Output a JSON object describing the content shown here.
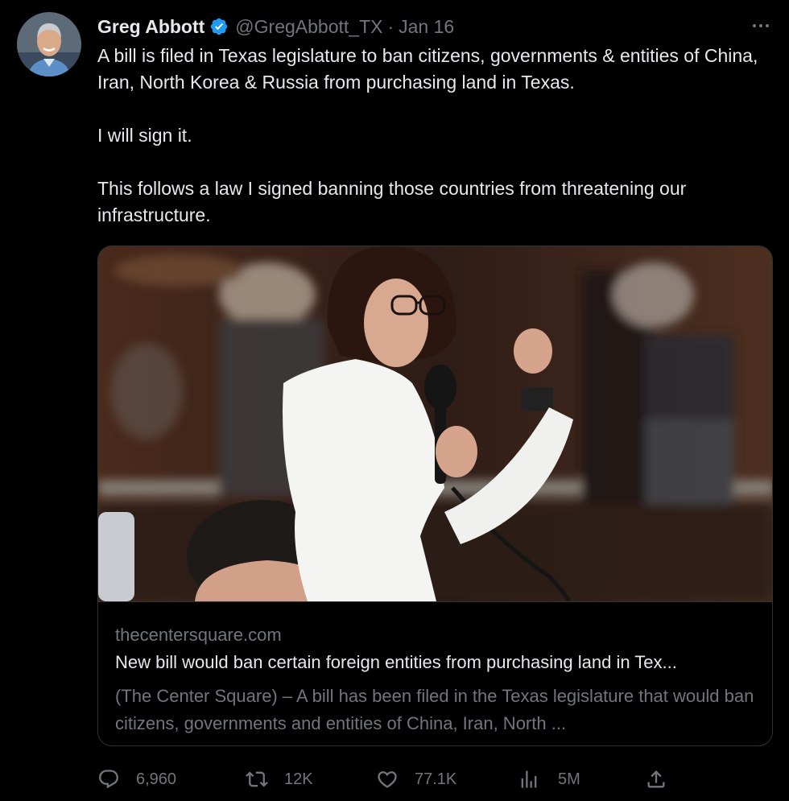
{
  "author": {
    "name": "Greg Abbott",
    "handle": "@GregAbbott_TX",
    "separator": "·",
    "date": "Jan 16",
    "verified": true,
    "avatar_icon": "profile-photo"
  },
  "tweet": {
    "paragraphs": [
      "A bill is filed in Texas legislature to ban citizens, governments & entities of China, Iran, North Korea & Russia from purchasing land in Texas.",
      "I will sign it.",
      "This follows a law I signed banning those countries from threatening our infrastructure."
    ]
  },
  "card": {
    "domain": "thecentersquare.com",
    "title": "New bill would ban certain foreign entities from purchasing land in Tex...",
    "description": "(The Center Square) – A bill has been filed in the Texas legislature that would ban citizens, governments and entities of China, Iran, North ...",
    "image_icon": "news-photo"
  },
  "actions": {
    "replies": "6,960",
    "retweets": "12K",
    "likes": "77.1K",
    "views": "5M"
  },
  "colors": {
    "background": "#000000",
    "primary_text": "#e7e9ea",
    "secondary_text": "#71767b",
    "border": "#2f3336",
    "verified_blue": "#1d9bf0"
  }
}
